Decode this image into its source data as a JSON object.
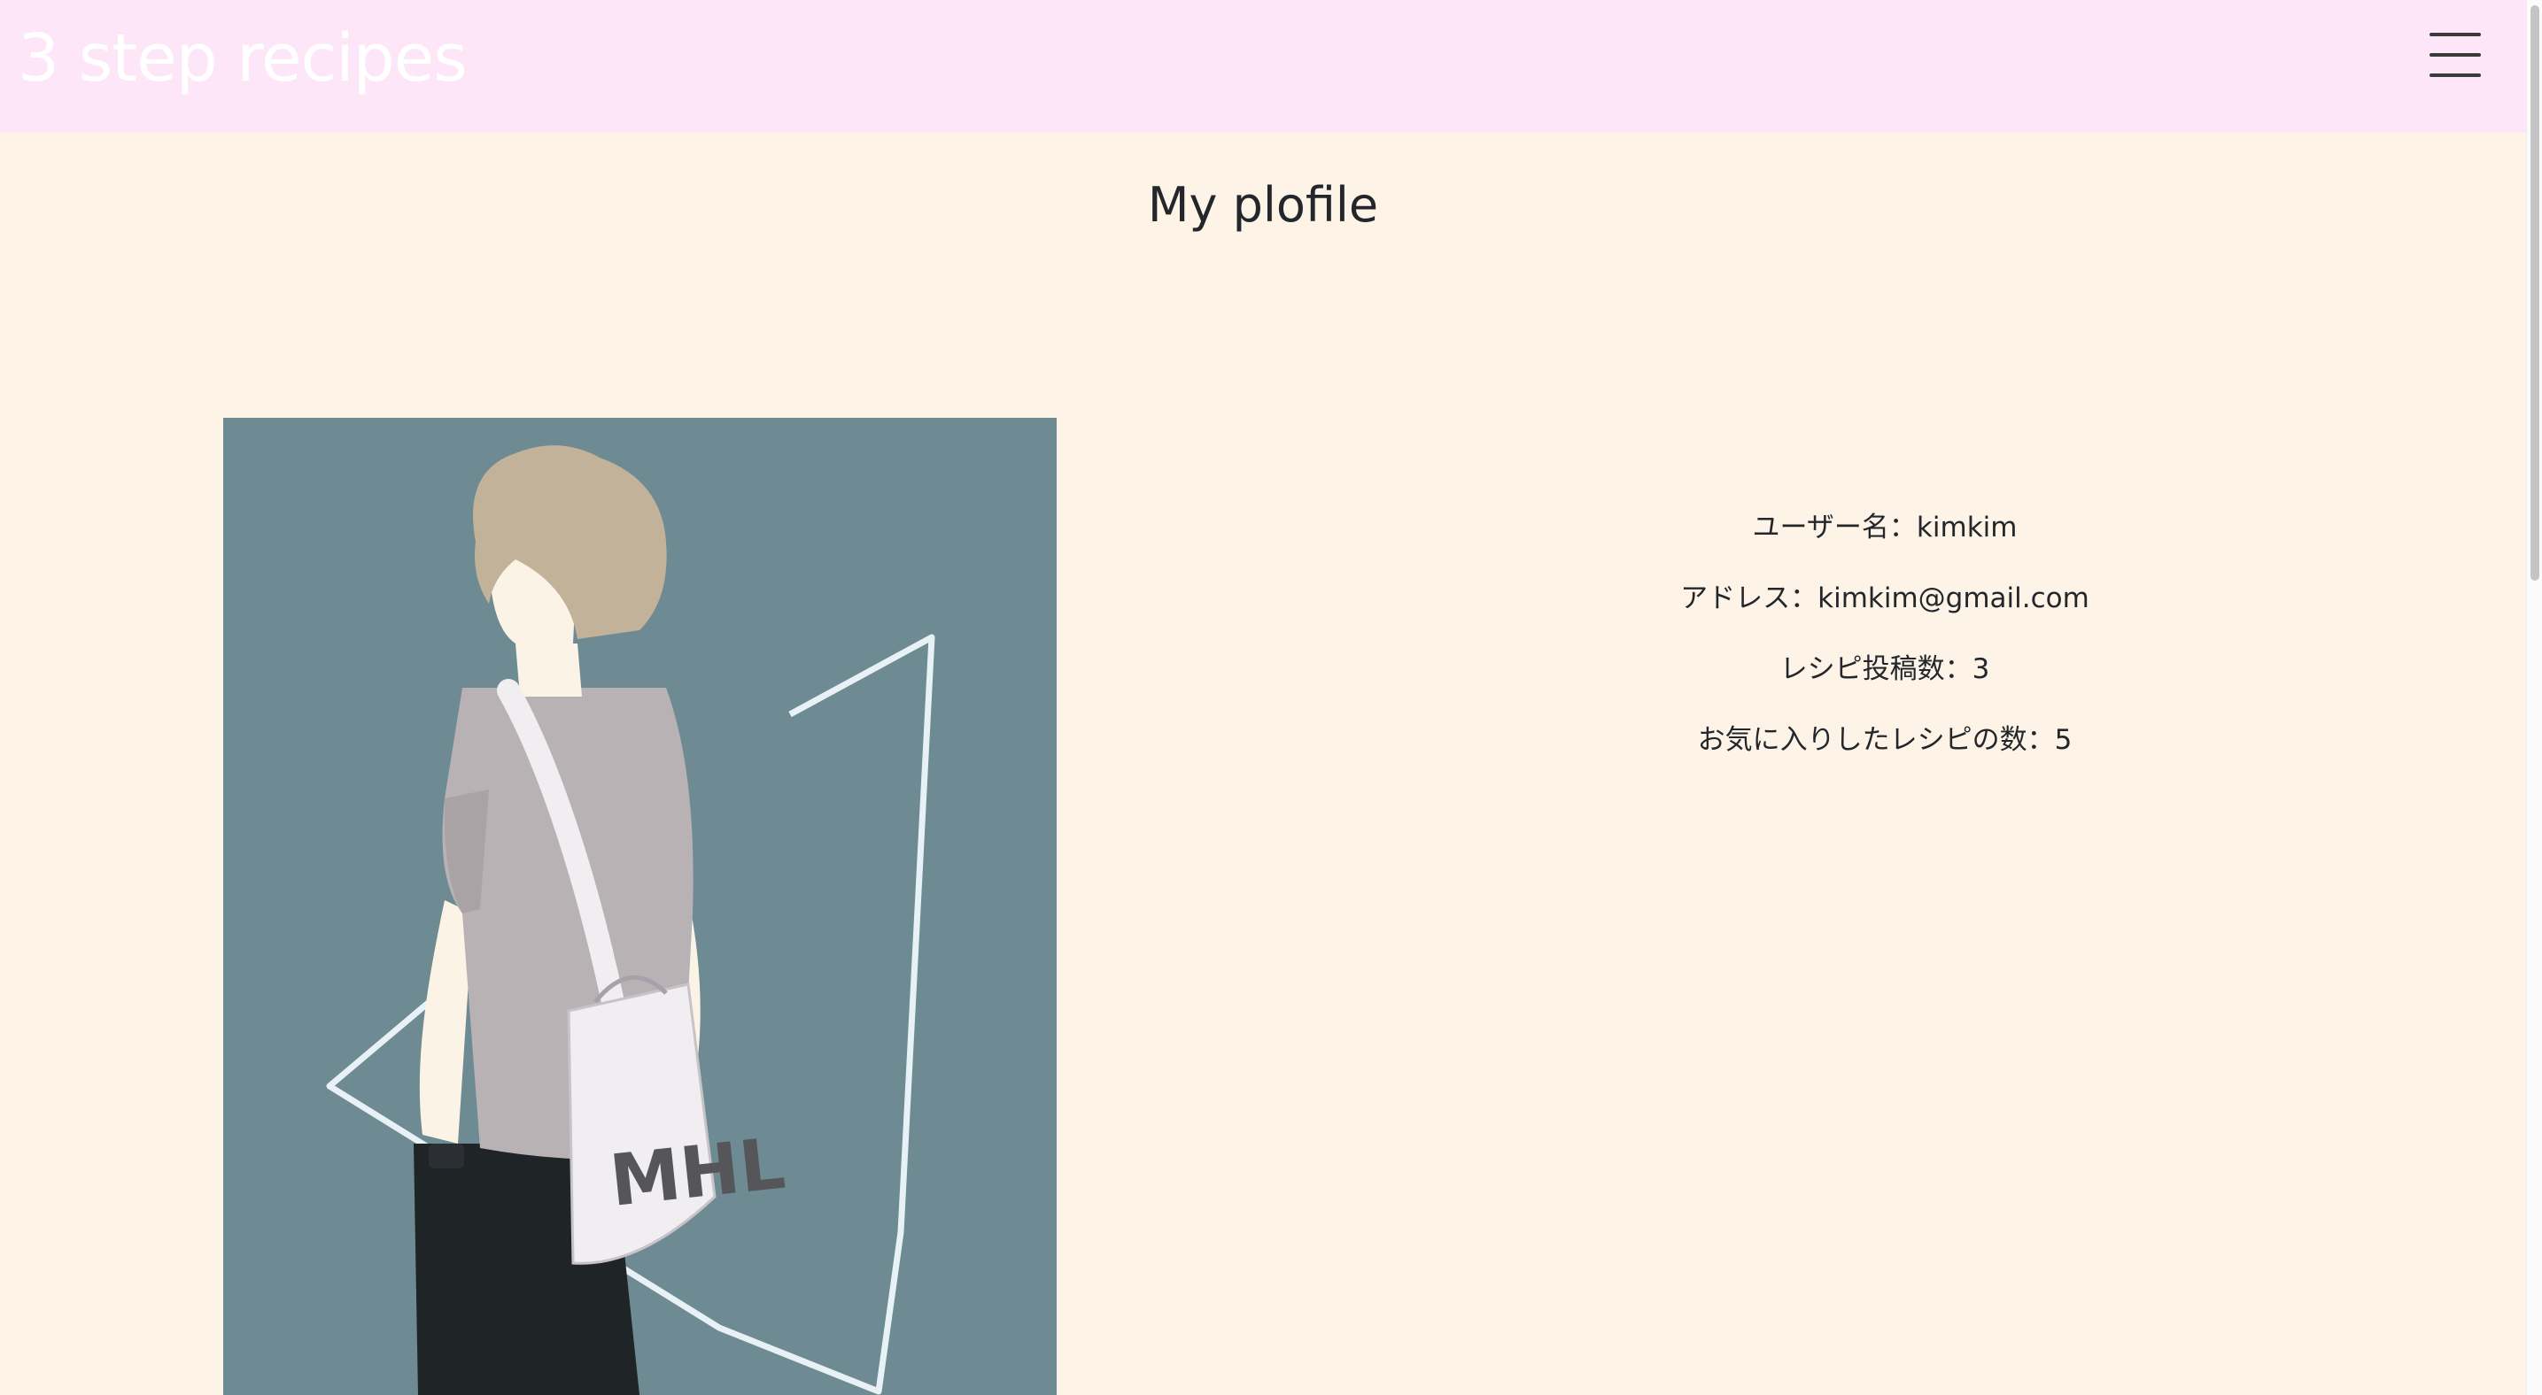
{
  "navbar": {
    "brand": "3 step recipes",
    "menu_icon": "hamburger-menu-icon"
  },
  "page": {
    "title": "My plofile"
  },
  "profile": {
    "image_alt": "illustrated figure of a person with a tote bag",
    "image_text": "MHL",
    "username": "ユーザー名：kimkim",
    "email": "アドレス：kimkim@gmail.com",
    "recipe_posts": "レシピ投稿数：3",
    "favorite_recipes": "お気に入りしたレシピの数：5"
  },
  "colors": {
    "navbar_bg": "#fde6f8",
    "page_bg": "#fdf4e7",
    "avatar_bg": "#6e8a92",
    "text": "#23272b"
  }
}
